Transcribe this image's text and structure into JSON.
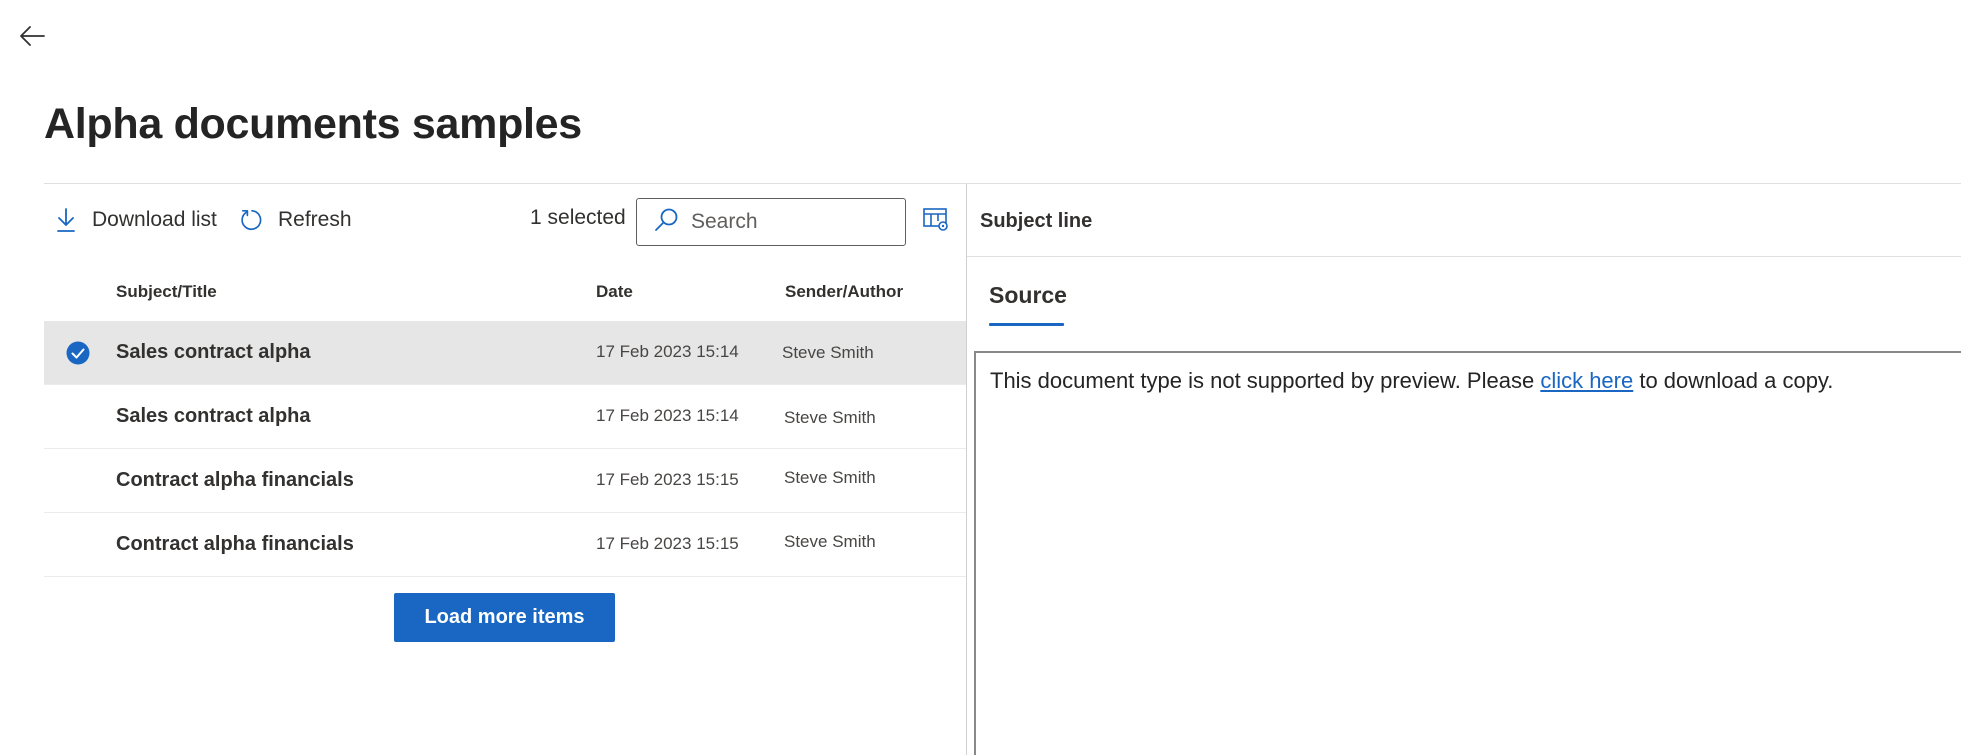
{
  "header": {
    "back_label": "Back",
    "title": "Alpha documents samples"
  },
  "toolbar": {
    "download_label": "Download list",
    "refresh_label": "Refresh",
    "selected_count": "1 selected",
    "search_placeholder": "Search",
    "search_value": ""
  },
  "list": {
    "columns": {
      "subject": "Subject/Title",
      "date": "Date",
      "sender": "Sender/Author"
    },
    "rows": [
      {
        "subject": "Sales contract alpha",
        "date": "17 Feb 2023 15:14",
        "sender": "Steve Smith",
        "selected": true
      },
      {
        "subject": "Sales contract alpha",
        "date": "17 Feb 2023 15:14",
        "sender": "Steve Smith",
        "selected": false
      },
      {
        "subject": "Contract alpha financials",
        "date": "17 Feb 2023 15:15",
        "sender": "Steve Smith",
        "selected": false
      },
      {
        "subject": "Contract alpha financials",
        "date": "17 Feb 2023 15:15",
        "sender": "Steve Smith",
        "selected": false
      }
    ],
    "load_more_label": "Load more items"
  },
  "preview": {
    "subject_line_label": "Subject line",
    "tabs": [
      {
        "label": "Source",
        "active": true
      }
    ],
    "message_before": "This document type is not supported by preview. Please ",
    "message_link": "click here",
    "message_after": " to download a copy."
  },
  "colors": {
    "accent": "#1967c2",
    "selected_row": "#e6e6e6",
    "text": "#242424"
  },
  "icons": {
    "back": "arrow-left-icon",
    "download": "download-icon",
    "refresh": "refresh-icon",
    "search": "search-icon",
    "column_settings": "table-settings-icon",
    "selected_check": "check-circle-icon"
  }
}
